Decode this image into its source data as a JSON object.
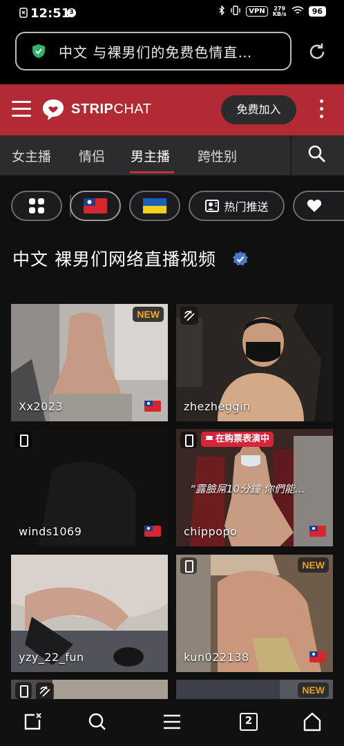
{
  "status_bar": {
    "time": "12:51",
    "notification_count": "3",
    "net_speed_top": "279",
    "net_speed_unit": "KB/s",
    "vpn": "VPN",
    "battery": "96"
  },
  "browser": {
    "url_text": "中文 与裸男们的免费色情直…",
    "tab_count": "2"
  },
  "header": {
    "logo_bold": "STRIP",
    "logo_thin": "CHAT",
    "join_label": "免费加入"
  },
  "tabs": [
    {
      "label": "女主播"
    },
    {
      "label": "情侣"
    },
    {
      "label": "男主播"
    },
    {
      "label": "跨性别"
    }
  ],
  "chips": {
    "hot_label": "热门推送"
  },
  "page_title": "中文 裸男们网络直播视频",
  "models": [
    {
      "name": "Xx2023",
      "badge": "NEW"
    },
    {
      "name": "zhezheggin"
    },
    {
      "name": "winds1069"
    },
    {
      "name": "chippopo",
      "badge": "在购票表演中",
      "topic": "“露臉屌10分鐘 你們能…"
    },
    {
      "name": "yzy_22_fun"
    },
    {
      "name": "kun022138",
      "badge": "NEW"
    },
    {
      "name": "",
      "badge": ""
    },
    {
      "name": "",
      "badge": "NEW"
    }
  ],
  "colors": {
    "brand_red": "#b22b34",
    "badge_orange": "#f4a51f",
    "ticket_red": "#d6243a",
    "verified_blue": "#4a78c7"
  }
}
